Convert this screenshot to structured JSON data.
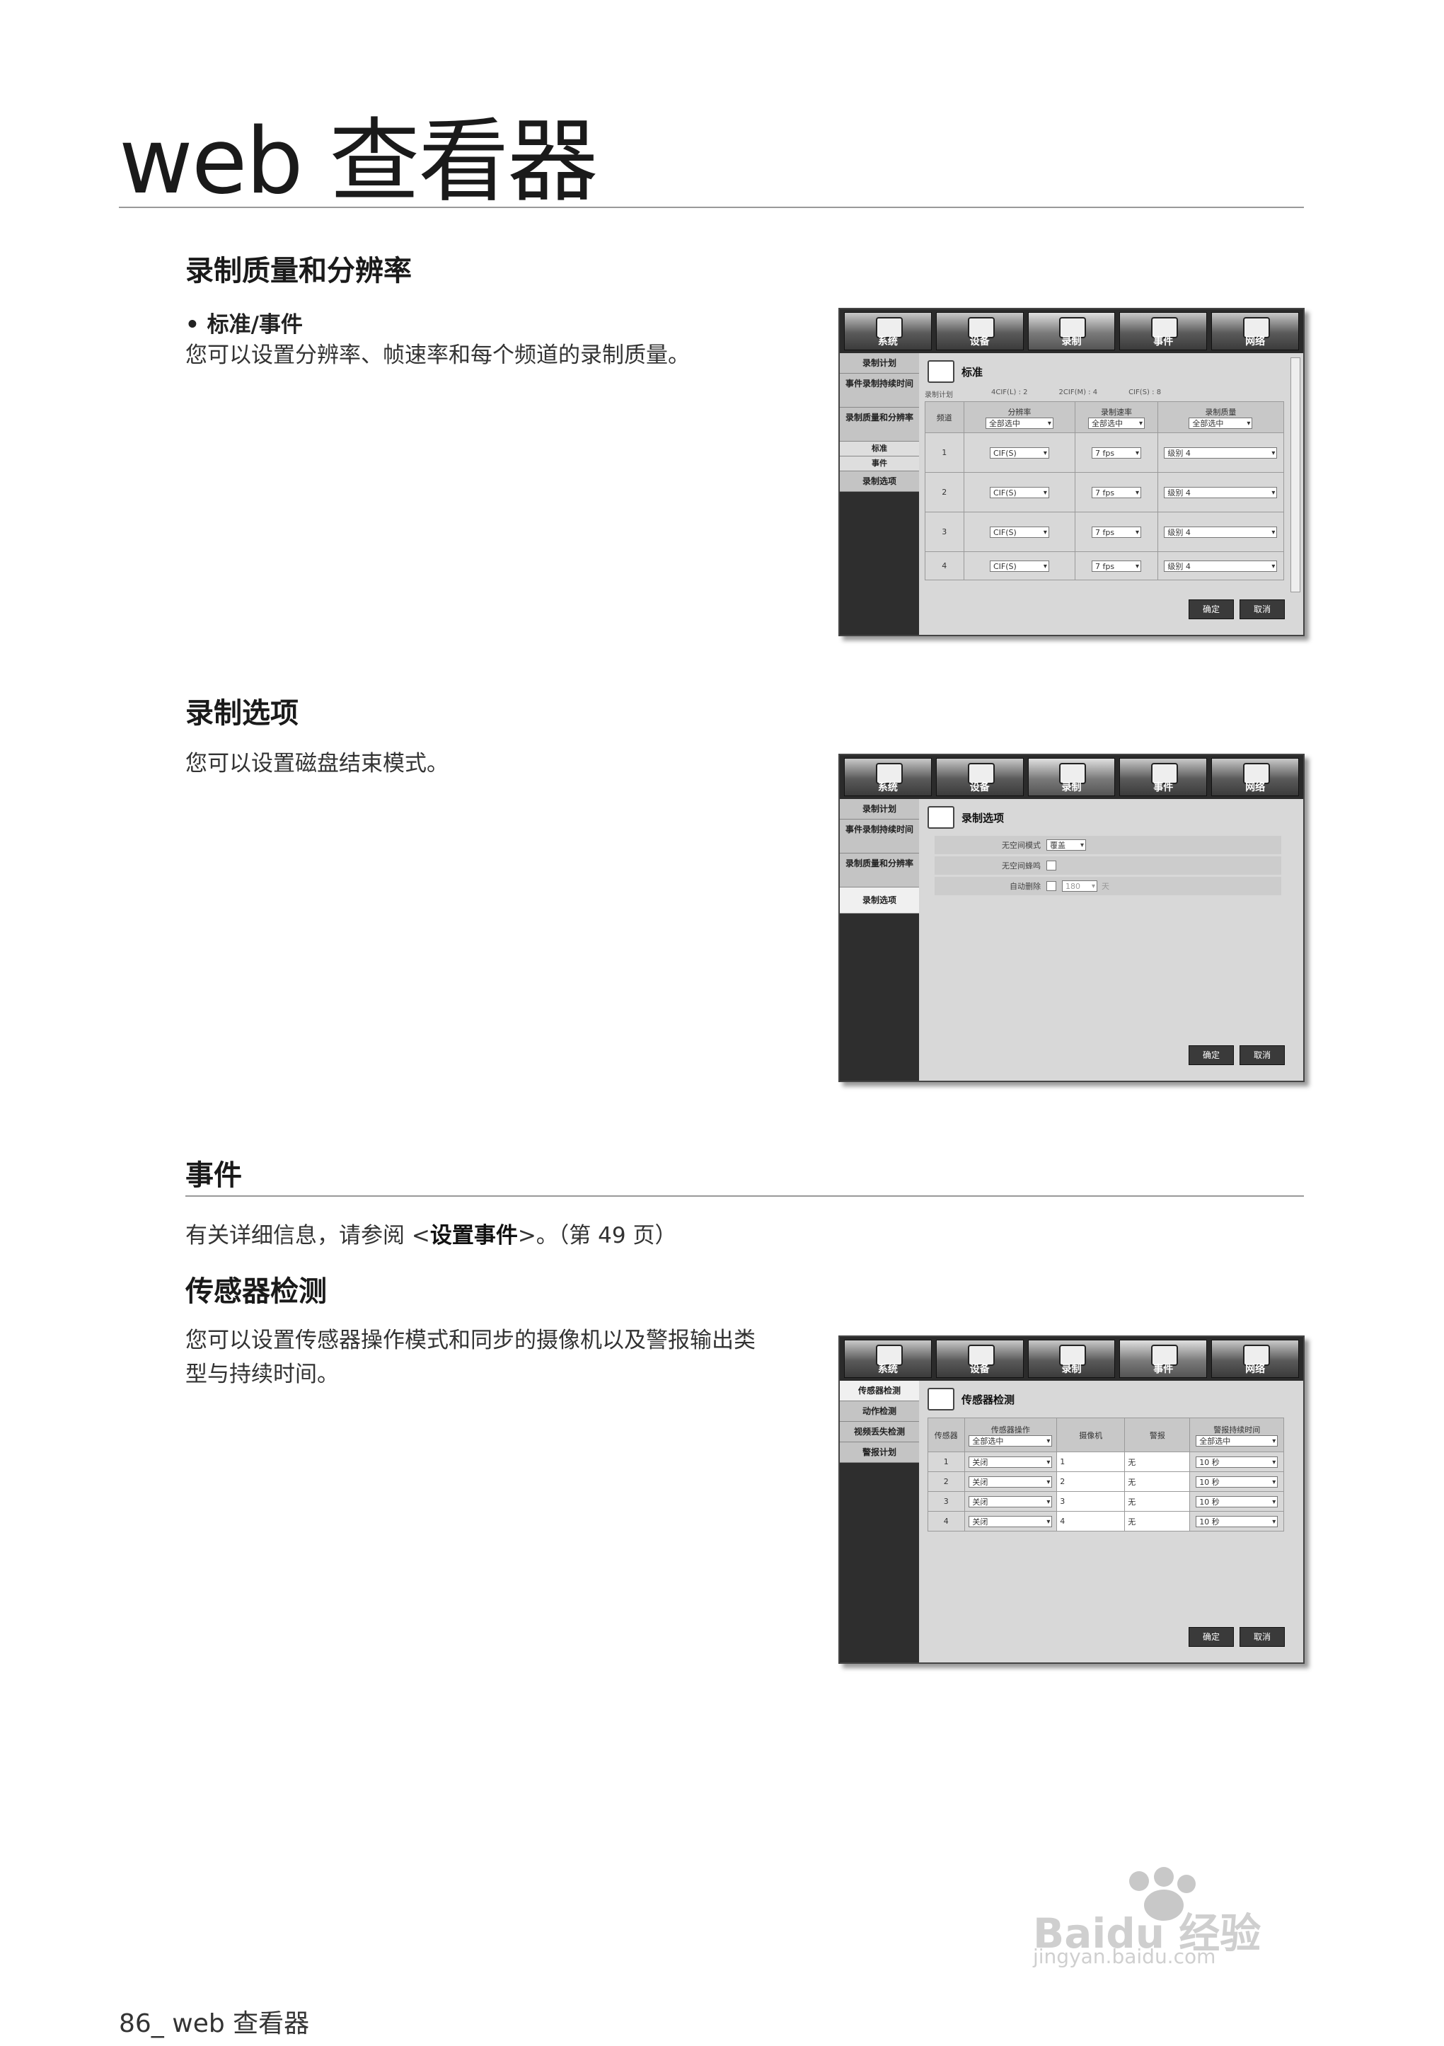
{
  "page": {
    "title": "web 查看器",
    "footer": "86_ web 查看器"
  },
  "sections": {
    "quality": {
      "heading": "录制质量和分辨率",
      "bullet": "• 标准/事件",
      "desc": "您可以设置分辨率、帧速率和每个频道的录制质量。"
    },
    "options": {
      "heading": "录制选项",
      "desc": "您可以设置磁盘结束模式。"
    },
    "event": {
      "heading": "事件",
      "desc_prefix": "有关详细信息，请参阅 <",
      "desc_link": "设置事件",
      "desc_suffix": ">。（第 49 页）"
    },
    "sensor": {
      "heading": "传感器检测",
      "desc_line1": "您可以设置传感器操作模式和同步的摄像机以及警报输出类",
      "desc_line2": "型与持续时间。"
    }
  },
  "topbar": [
    "系统",
    "设备",
    "录制",
    "事件",
    "网络"
  ],
  "shot1": {
    "sidebar": [
      "录制计划",
      "事件录制持续时间",
      "录制质量和分辨率",
      "标准",
      "事件",
      "录制选项"
    ],
    "title": "标准",
    "summary": {
      "label": "录制计划",
      "l_label": "4CIF(L) :",
      "l_val": "2",
      "m_label": "2CIF(M) :",
      "m_val": "4",
      "s_label": "CIF(S) :",
      "s_val": "8"
    },
    "columns": [
      "频道",
      "分辨率",
      "录制速率",
      "录制质量"
    ],
    "all_label": "全部选中",
    "rows": [
      {
        "ch": "1",
        "res": "CIF(S)",
        "fps": "7 fps",
        "q": "级别 4"
      },
      {
        "ch": "2",
        "res": "CIF(S)",
        "fps": "7 fps",
        "q": "级别 4"
      },
      {
        "ch": "3",
        "res": "CIF(S)",
        "fps": "7 fps",
        "q": "级别 4"
      },
      {
        "ch": "4",
        "res": "CIF(S)",
        "fps": "7 fps",
        "q": "级别 4"
      }
    ],
    "ok": "确定",
    "cancel": "取消"
  },
  "shot2": {
    "sidebar": [
      "录制计划",
      "事件录制持续时间",
      "录制质量和分辨率",
      "录制选项"
    ],
    "title": "录制选项",
    "fields": [
      {
        "label": "无空间模式",
        "value": "覆盖"
      },
      {
        "label": "无空间蜂鸣",
        "value": ""
      },
      {
        "label": "自动删除",
        "value": "180",
        "unit": "天"
      }
    ],
    "ok": "确定",
    "cancel": "取消"
  },
  "shot3": {
    "sidebar": [
      "传感器检测",
      "动作检测",
      "视频丢失检测",
      "警报计划"
    ],
    "title": "传感器检测",
    "columns": [
      "传感器",
      "传感器操作",
      "摄像机",
      "警报",
      "警报持续时间"
    ],
    "all_label": "全部选中",
    "rows": [
      {
        "n": "1",
        "op": "关闭",
        "cam": "1",
        "alarm": "无",
        "dur": "10 秒"
      },
      {
        "n": "2",
        "op": "关闭",
        "cam": "2",
        "alarm": "无",
        "dur": "10 秒"
      },
      {
        "n": "3",
        "op": "关闭",
        "cam": "3",
        "alarm": "无",
        "dur": "10 秒"
      },
      {
        "n": "4",
        "op": "关闭",
        "cam": "4",
        "alarm": "无",
        "dur": "10 秒"
      }
    ],
    "ok": "确定",
    "cancel": "取消"
  },
  "watermark": {
    "brand": "Baidu 经验",
    "url": "jingyan.baidu.com"
  }
}
